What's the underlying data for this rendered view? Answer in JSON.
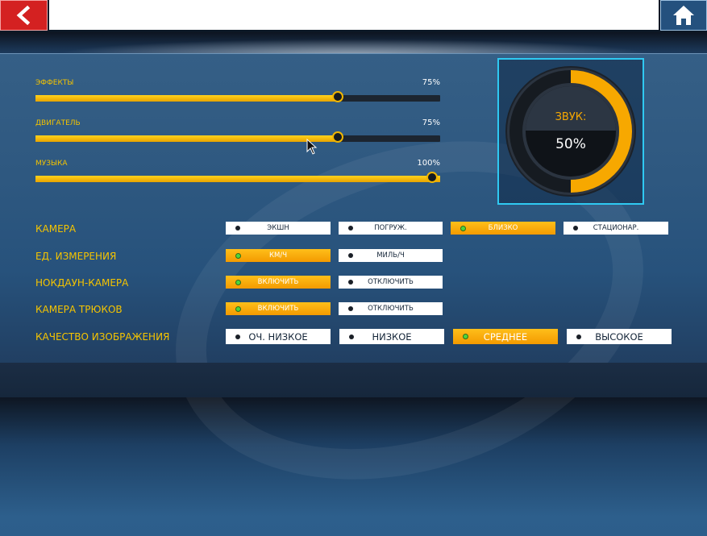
{
  "header": {
    "back_icon": "chevron-left-icon",
    "home_icon": "home-icon",
    "title": ""
  },
  "sliders": [
    {
      "label": "ЭФФЕКТЫ",
      "value_text": "75%",
      "value": 0.75
    },
    {
      "label": "ДВИГАТЕЛЬ",
      "value_text": "75%",
      "value": 0.75
    },
    {
      "label": "МУЗЫКА",
      "value_text": "100%",
      "value": 1.0
    }
  ],
  "gauge": {
    "label": "ЗВУК:",
    "value_text": "50%",
    "value": 0.5,
    "accent": "#f7a800",
    "frame_color": "#2fc9f2"
  },
  "settings": [
    {
      "label": "КАМЕРА",
      "options": [
        "ЭКШН",
        "ПОГРУЖ.",
        "БЛИЗКО",
        "СТАЦИОНАР."
      ],
      "selected": 2
    },
    {
      "label": "ЕД. ИЗМЕРЕНИЯ",
      "options": [
        "КМ/Ч",
        "МИЛЬ/Ч"
      ],
      "selected": 0
    },
    {
      "label": "НОКДАУН-КАМЕРА",
      "options": [
        "ВКЛЮЧИТЬ",
        "ОТКЛЮЧИТЬ"
      ],
      "selected": 0
    },
    {
      "label": "КАМЕРА ТРЮКОВ",
      "options": [
        "ВКЛЮЧИТЬ",
        "ОТКЛЮЧИТЬ"
      ],
      "selected": 0
    },
    {
      "label": "КАЧЕСТВО ИЗОБРАЖЕНИЯ",
      "options": [
        "ОЧ. НИЗКОЕ",
        "НИЗКОЕ",
        "СРЕДНЕЕ",
        "ВЫСОКОЕ"
      ],
      "selected": 2
    }
  ],
  "colors": {
    "accent": "#f5c400",
    "selected": "#f39a00",
    "back": "#d42121",
    "home": "#24517e"
  }
}
